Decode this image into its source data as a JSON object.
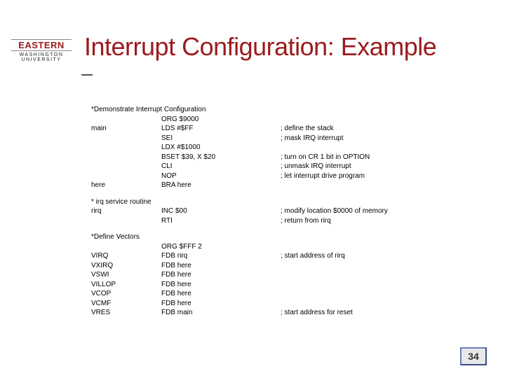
{
  "logo": {
    "name": "EASTERN",
    "sub": "WASHINGTON UNIVERSITY"
  },
  "title": "Interrupt Configuration: Example",
  "code": {
    "section1": {
      "header": "*Demonstrate Interrupt Configuration",
      "rows": [
        {
          "label": "",
          "instr": "ORG $9000",
          "comment": ""
        },
        {
          "label": "main",
          "instr": "LDS #$FF",
          "comment": "; define the stack"
        },
        {
          "label": "",
          "instr": "SEI",
          "comment": "; mask IRQ interrupt"
        },
        {
          "label": "",
          "instr": "LDX #$1000",
          "comment": ""
        },
        {
          "label": "",
          "instr": "BSET $39, X $20",
          "comment": "; turn on CR 1 bit in OPTION"
        },
        {
          "label": "",
          "instr": "CLI",
          "comment": "; unmask IRQ interrupt"
        },
        {
          "label": "",
          "instr": "NOP",
          "comment": "; let interrupt drive program"
        },
        {
          "label": "here",
          "instr": "BRA here",
          "comment": ""
        }
      ]
    },
    "section2": {
      "header": "* irq service routine",
      "rows": [
        {
          "label": "rirq",
          "instr": "INC $00",
          "comment": "; modify location $0000 of memory"
        },
        {
          "label": "",
          "instr": "RTI",
          "comment": "; return from rirq"
        }
      ]
    },
    "section3": {
      "header": "*Define Vectors",
      "rows": [
        {
          "label": "",
          "instr": "ORG $FFF 2",
          "comment": ""
        },
        {
          "label": "VIRQ",
          "instr": "FDB rirq",
          "comment": "; start address of rirq"
        },
        {
          "label": "VXIRQ",
          "instr": "FDB here",
          "comment": ""
        },
        {
          "label": "VSWI",
          "instr": "FDB here",
          "comment": ""
        },
        {
          "label": "VILLOP",
          "instr": "FDB here",
          "comment": ""
        },
        {
          "label": "VCOP",
          "instr": "FDB here",
          "comment": ""
        },
        {
          "label": "VCMF",
          "instr": "FDB here",
          "comment": ""
        },
        {
          "label": "VRES",
          "instr": "FDB main",
          "comment": "; start address for reset"
        }
      ]
    }
  },
  "page_number": "34"
}
